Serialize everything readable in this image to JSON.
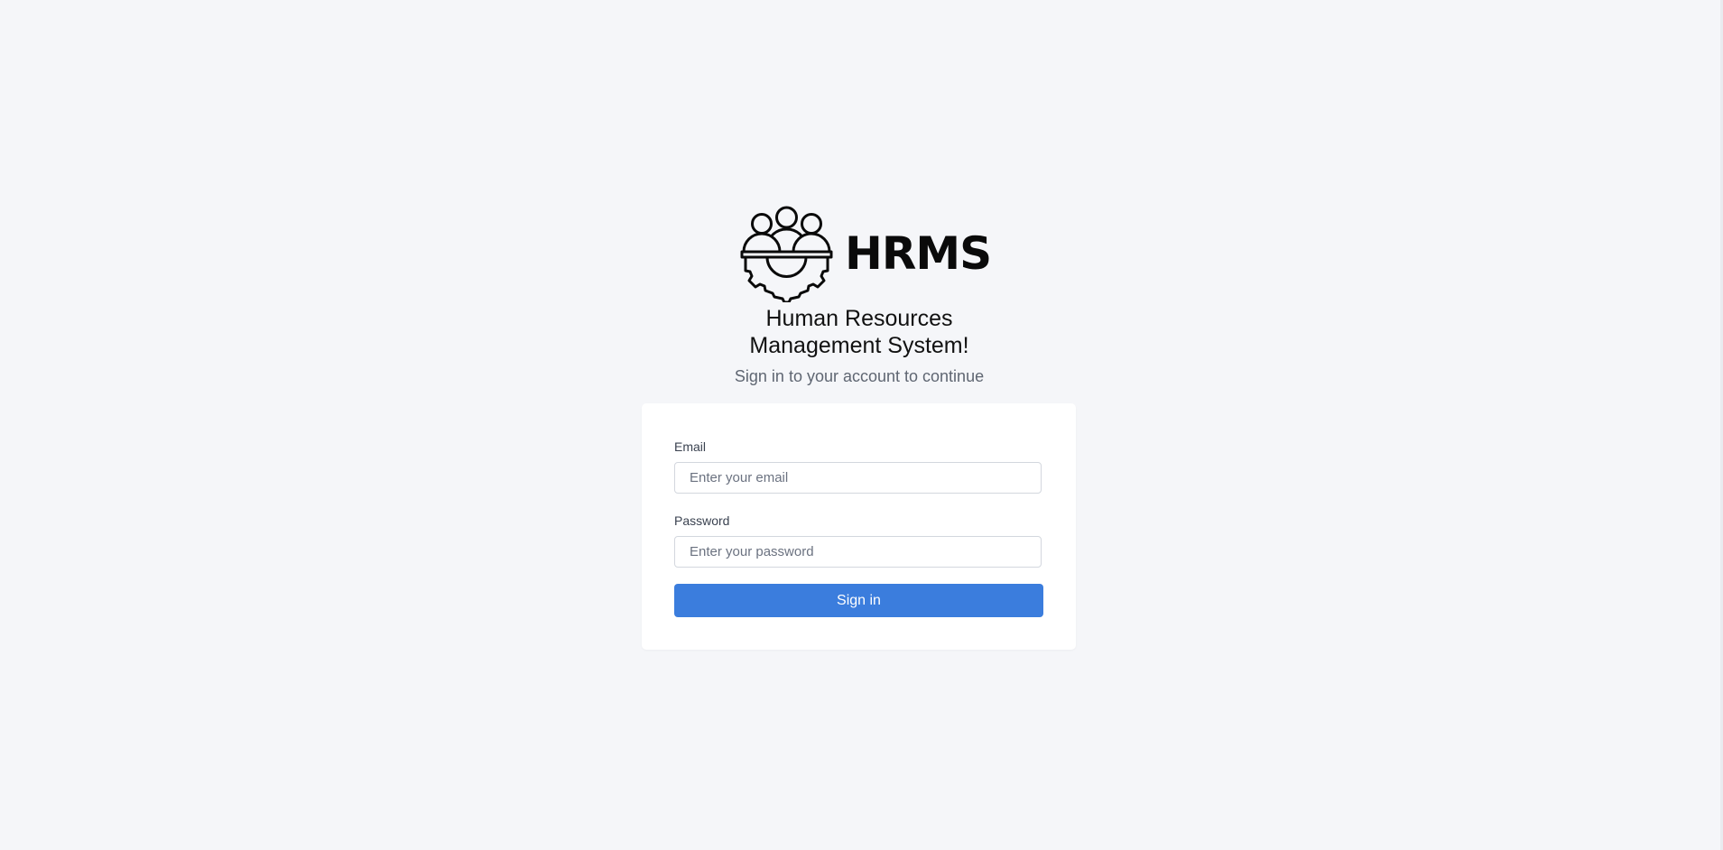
{
  "brand": {
    "logo_icon": "people-gear-icon",
    "name": "HRMS"
  },
  "header": {
    "title_line1": "Human Resources",
    "title_line2": "Management System!",
    "subtitle": "Sign in to your account to continue"
  },
  "form": {
    "email": {
      "label": "Email",
      "placeholder": "Enter your email",
      "value": ""
    },
    "password": {
      "label": "Password",
      "placeholder": "Enter your password",
      "value": ""
    },
    "submit_label": "Sign in"
  },
  "colors": {
    "background": "#f5f6f9",
    "card": "#ffffff",
    "accent": "#3b7ddd",
    "text_muted": "#5f6672"
  }
}
